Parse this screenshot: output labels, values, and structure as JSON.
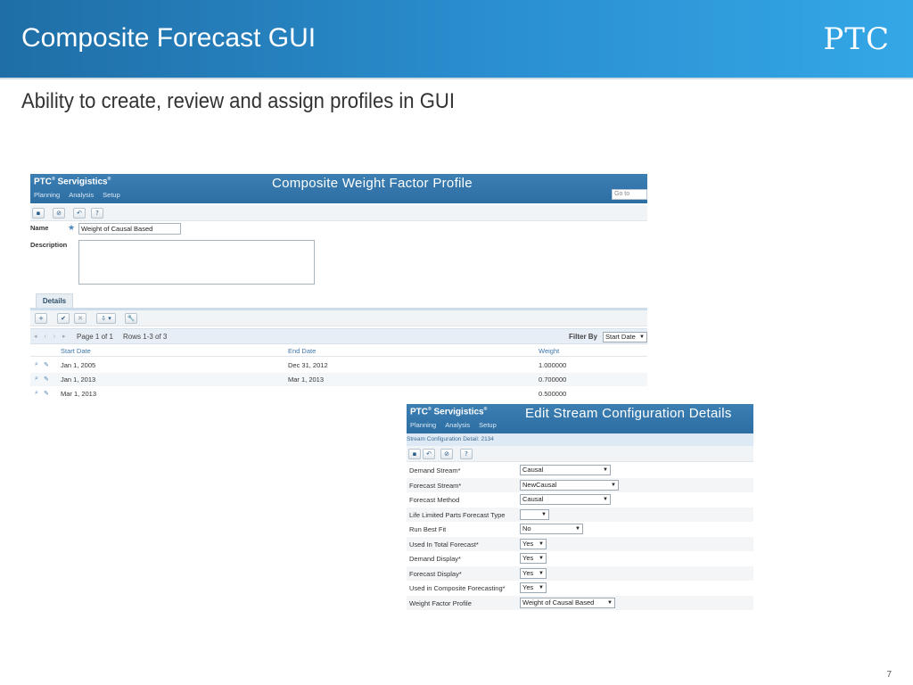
{
  "slide": {
    "title": "Composite Forecast GUI",
    "brand": "PTC",
    "subtitle": "Ability to create, review and assign profiles in GUI",
    "page_number": "7"
  },
  "colors": {
    "header_blue": "#2a8fd0",
    "app_bar_blue": "#2d6ea3",
    "link_blue": "#3f78ad"
  },
  "screen1": {
    "brand": "PTC",
    "brand_suffix": "Servigistics",
    "menu": [
      "Planning",
      "Analysis",
      "Setup"
    ],
    "page_title": "Composite Weight Factor Profile",
    "goto_placeholder": "Go to",
    "toolbar_icons": [
      "save-icon",
      "cancel-icon",
      "undo-icon",
      "help-icon"
    ],
    "toolbar_glyphs": [
      "▪",
      "⊘",
      "↶",
      "?"
    ],
    "name_label": "Name",
    "name_value": "Weight of Causal Based",
    "description_label": "Description",
    "description_value": "",
    "details_tab": "Details",
    "details_toolbar_icons": [
      "add-icon",
      "confirm-icon",
      "delete-icon",
      "export-icon",
      "settings-icon"
    ],
    "details_toolbar_glyphs": [
      "+",
      "✔",
      "✖",
      "⇩ ▾",
      "🔧"
    ],
    "pager": {
      "page": "Page 1 of 1",
      "rows": "Rows 1-3 of 3",
      "filter_label": "Filter By",
      "filter_value": "Start Date"
    },
    "table": {
      "headers": [
        "Start Date",
        "End Date",
        "Weight"
      ],
      "rows": [
        [
          "Jan 1, 2005",
          "Dec 31, 2012",
          "1.000000"
        ],
        [
          "Jan 1, 2013",
          "Mar 1, 2013",
          "0.700000"
        ],
        [
          "Mar 1, 2013",
          "",
          "0.500000"
        ]
      ]
    }
  },
  "screen2": {
    "brand": "PTC",
    "brand_suffix": "Servigistics",
    "menu": [
      "Planning",
      "Analysis",
      "Setup"
    ],
    "page_title": "Edit Stream Configuration Details",
    "breadcrumb": "Stream Configuration Detail: 2134",
    "toolbar_icons": [
      "save-icon",
      "undo-icon",
      "cancel-icon",
      "help-icon"
    ],
    "toolbar_glyphs": [
      "▪",
      "↶",
      "⊘",
      "?"
    ],
    "fields": [
      {
        "label": "Demand Stream*",
        "value": "Causal"
      },
      {
        "label": "Forecast Stream*",
        "value": "NewCausal"
      },
      {
        "label": "Forecast Method",
        "value": "Causal"
      },
      {
        "label": "Life Limited Parts Forecast Type",
        "value": ""
      },
      {
        "label": "Run Best Fit",
        "value": "No"
      },
      {
        "label": "Used In Total Forecast*",
        "value": "Yes"
      },
      {
        "label": "Demand Display*",
        "value": "Yes"
      },
      {
        "label": "Forecast Display*",
        "value": "Yes"
      },
      {
        "label": "Used in Composite Forecasting*",
        "value": "Yes"
      },
      {
        "label": "Weight Factor Profile",
        "value": "Weight of Causal Based"
      }
    ]
  }
}
